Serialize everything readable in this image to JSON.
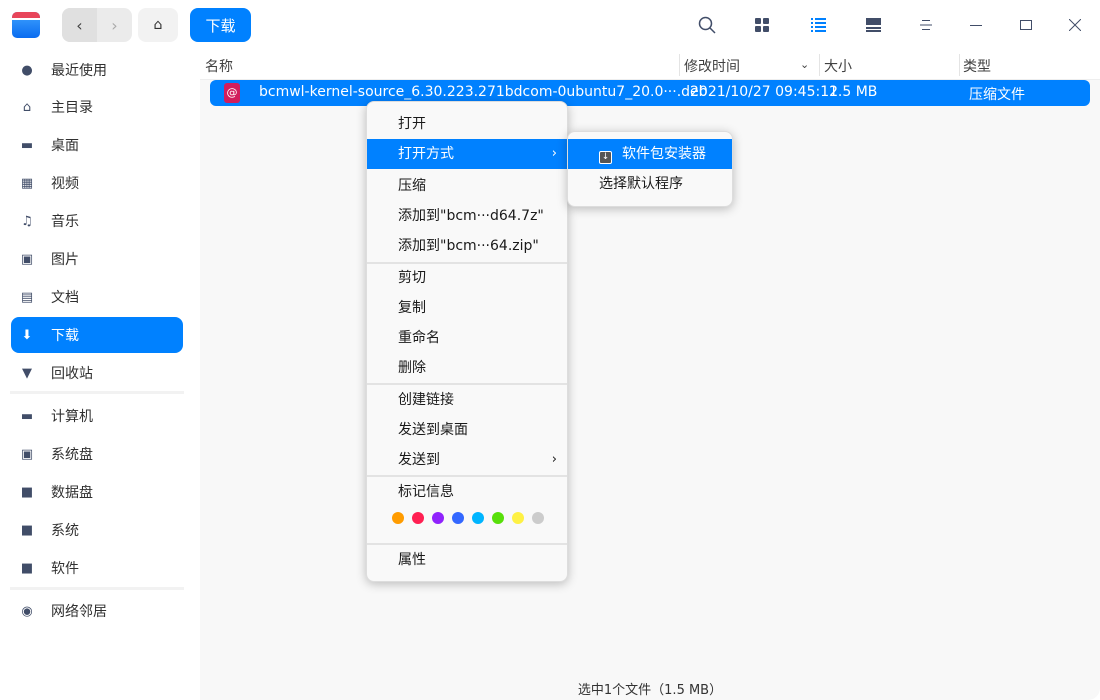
{
  "toolbar": {
    "breadcrumb": "下载",
    "back_icon": "‹",
    "forward_icon": "›"
  },
  "sidebar": {
    "items": [
      {
        "label": "最近使用",
        "icon": "clock-icon"
      },
      {
        "label": "主目录",
        "icon": "home-icon"
      },
      {
        "label": "桌面",
        "icon": "desktop-icon"
      },
      {
        "label": "视频",
        "icon": "video-icon"
      },
      {
        "label": "音乐",
        "icon": "music-icon"
      },
      {
        "label": "图片",
        "icon": "picture-icon"
      },
      {
        "label": "文档",
        "icon": "document-icon"
      },
      {
        "label": "下载",
        "icon": "download-icon",
        "selected": true
      },
      {
        "label": "回收站",
        "icon": "trash-icon"
      },
      {
        "label": "计算机",
        "icon": "computer-icon"
      },
      {
        "label": "系统盘",
        "icon": "system-disk-icon"
      },
      {
        "label": "数据盘",
        "icon": "disk-icon"
      },
      {
        "label": "系统",
        "icon": "disk-icon"
      },
      {
        "label": "软件",
        "icon": "disk-icon"
      },
      {
        "label": "网络邻居",
        "icon": "network-icon"
      }
    ]
  },
  "columns": {
    "name": "名称",
    "modified": "修改时间",
    "size": "大小",
    "type": "类型"
  },
  "files": [
    {
      "name": "bcmwl-kernel-source_6.30.223.271bdcom-0ubuntu7_20.0···.deb",
      "modified": "2021/10/27 09:45:12",
      "size": "1.5 MB",
      "type": "压缩文件"
    }
  ],
  "status": "选中1个文件（1.5 MB）",
  "context_menu": {
    "open": "打开",
    "open_with": "打开方式",
    "compress": "压缩",
    "add_7z": "添加到\"bcm···d64.7z\"",
    "add_zip": "添加到\"bcm···64.zip\"",
    "cut": "剪切",
    "copy": "复制",
    "rename": "重命名",
    "delete": "删除",
    "create_link": "创建链接",
    "send_to_desktop": "发送到桌面",
    "send_to": "发送到",
    "tag_info": "标记信息",
    "properties": "属性",
    "tag_colors": [
      "#ff9c00",
      "#ff2052",
      "#9023fc",
      "#3468ff",
      "#00b5ff",
      "#58df0a",
      "#fef144",
      "#cccccc"
    ]
  },
  "submenu": {
    "package_installer": "软件包安装器",
    "choose_default": "选择默认程序"
  },
  "colors": {
    "accent": "#0081ff"
  }
}
